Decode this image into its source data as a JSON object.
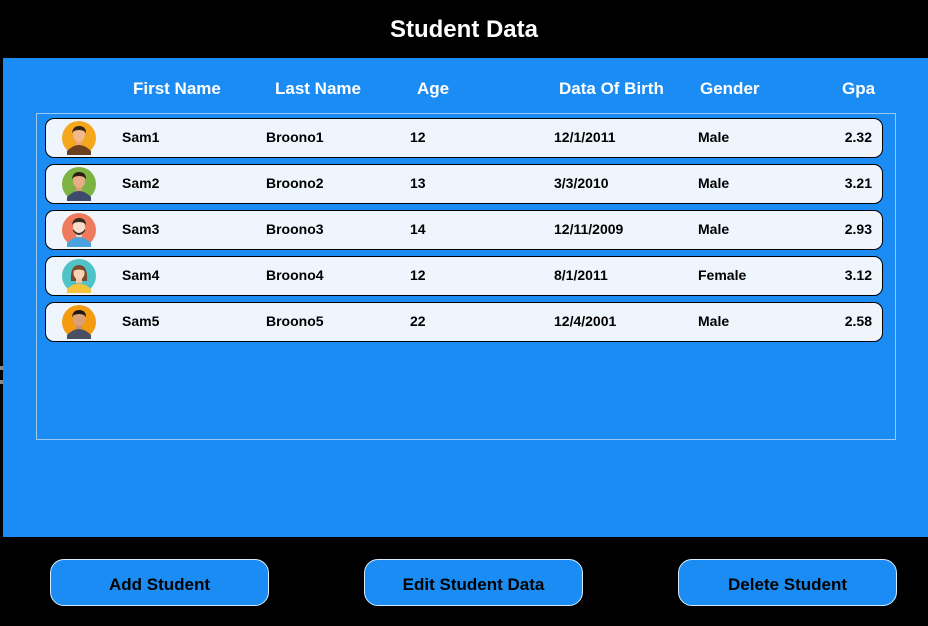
{
  "window": {
    "title": "Student Data"
  },
  "columns": {
    "first_name": "First Name",
    "last_name": "Last Name",
    "age": "Age",
    "dob": "Data Of Birth",
    "gender": "Gender",
    "gpa": "Gpa"
  },
  "students": [
    {
      "first": "Sam1",
      "last": "Broono1",
      "age": "12",
      "dob": "12/1/2011",
      "gender": "Male",
      "gpa": "2.32",
      "avatar": "male-avatar-icon"
    },
    {
      "first": "Sam2",
      "last": "Broono2",
      "age": "13",
      "dob": "3/3/2010",
      "gender": "Male",
      "gpa": "3.21",
      "avatar": "male-avatar-icon"
    },
    {
      "first": "Sam3",
      "last": "Broono3",
      "age": "14",
      "dob": "12/11/2009",
      "gender": "Male",
      "gpa": "2.93",
      "avatar": "male-avatar-icon"
    },
    {
      "first": "Sam4",
      "last": "Broono4",
      "age": "12",
      "dob": "8/1/2011",
      "gender": "Female",
      "gpa": "3.12",
      "avatar": "female-avatar-icon"
    },
    {
      "first": "Sam5",
      "last": "Broono5",
      "age": "22",
      "dob": "12/4/2001",
      "gender": "Male",
      "gpa": "2.58",
      "avatar": "male-avatar-icon"
    }
  ],
  "actions": {
    "add": "Add Student",
    "edit": "Edit Student Data",
    "delete": "Delete Student"
  },
  "colors": {
    "background": "#000000",
    "panel": "#1a8cf3",
    "row": "#eef5fd",
    "button": "#1a8cf3"
  }
}
